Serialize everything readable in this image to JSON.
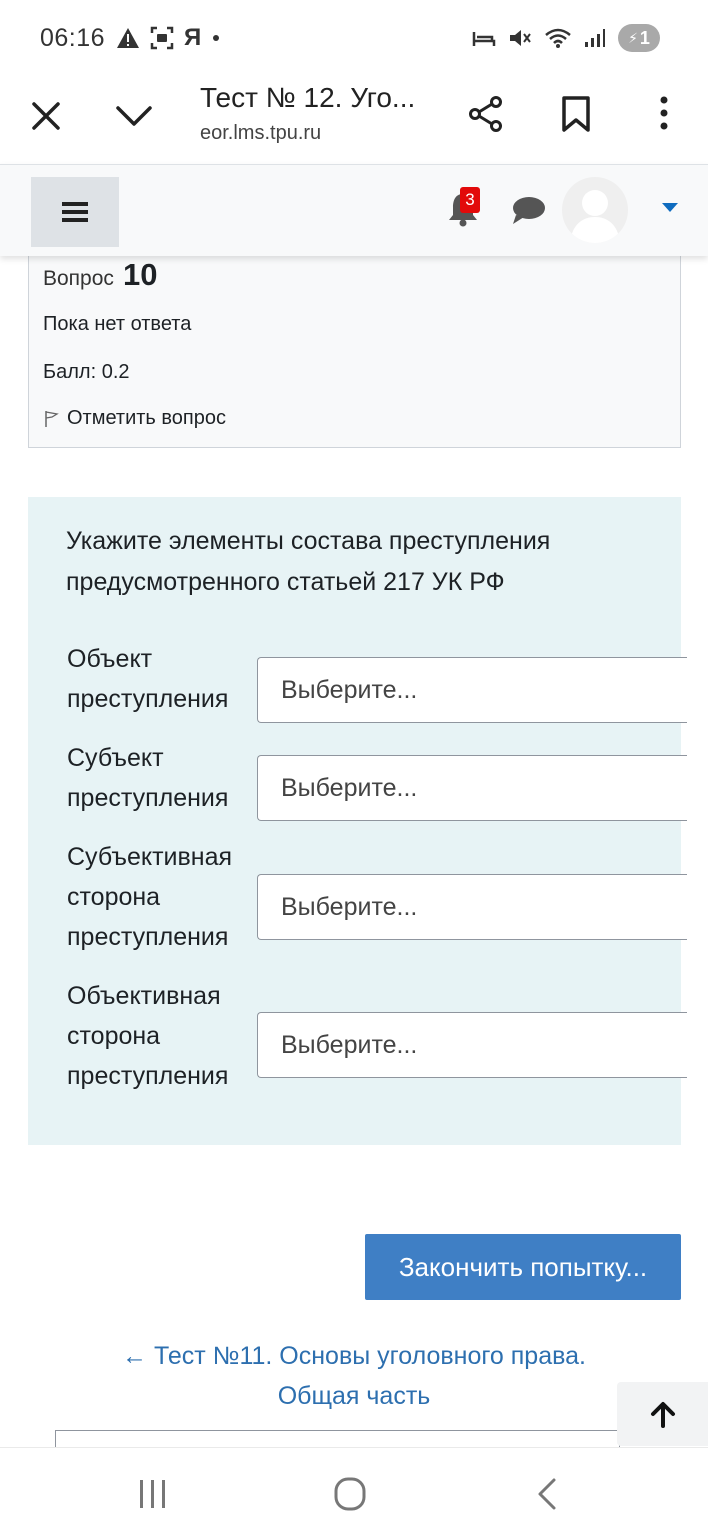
{
  "status_bar": {
    "time": "06:16",
    "left_indicators": [
      "warning-icon",
      "screenshot-icon",
      "yandex-icon",
      "dot-icon"
    ],
    "yandex_letter": "Я",
    "right_indicators": [
      "sleep-icon",
      "mute-icon",
      "wifi-icon",
      "signal-icon"
    ],
    "battery_level": "1"
  },
  "browser": {
    "title": "Тест № 12. Уго...",
    "url": "eor.lms.tpu.ru"
  },
  "navbar": {
    "notification_count": "3",
    "accent_color": "#0f6cbf"
  },
  "question_info": {
    "label": "Вопрос",
    "number": "10",
    "state": "Пока нет ответа",
    "grade": "Балл: 0.2",
    "flag_label": "Отметить вопрос"
  },
  "question": {
    "text": "Укажите элементы состава преступления предусмотренного статьей 217 УК РФ",
    "rows": [
      {
        "label": "Объект преступления",
        "select_value": "Выберите..."
      },
      {
        "label": "Субъект преступления",
        "select_value": "Выберите..."
      },
      {
        "label": "Субъективная сторона преступления",
        "select_value": "Выберите..."
      },
      {
        "label": "Объективная сторона преступления",
        "select_value": "Выберите..."
      }
    ]
  },
  "actions": {
    "finish_label": "Закончить попытку...",
    "finish_color": "#3f7fc5"
  },
  "navigation": {
    "prev_link": "← Тест №11. Основы уголовного права. Общая часть"
  }
}
